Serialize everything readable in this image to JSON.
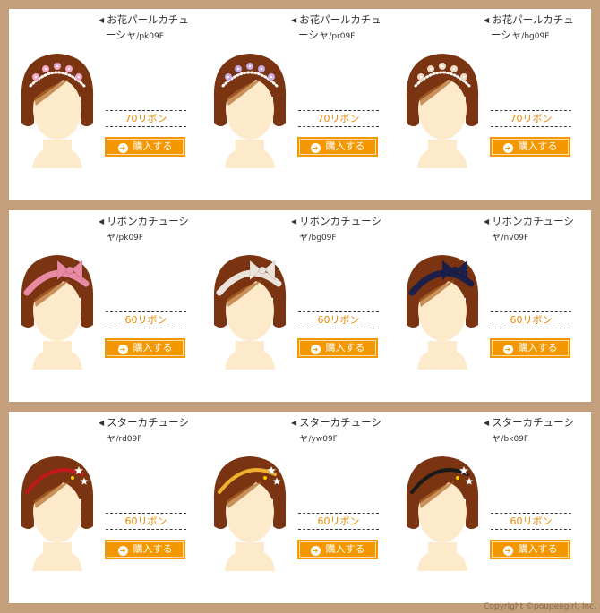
{
  "buy_label": "購入する",
  "copyright": "Copyright ©poupeegirl, Inc.",
  "colors": {
    "background": "#c49f7b",
    "button": "#f39800",
    "price_text": "#e98a00",
    "hair": "#7a3412",
    "skin": "#fdeacb"
  },
  "rows": [
    {
      "items": [
        {
          "line1": "お花パールカチュ",
          "line2": "ーシャ",
          "sku": "/pk09F",
          "price": "70リボン",
          "accessory": "flower-pearl",
          "color": "#f2a7c2"
        },
        {
          "line1": "お花パールカチュ",
          "line2": "ーシャ",
          "sku": "/pr09F",
          "price": "70リボン",
          "accessory": "flower-pearl",
          "color": "#c8a8e0"
        },
        {
          "line1": "お花パールカチュ",
          "line2": "ーシャ",
          "sku": "/bg09F",
          "price": "70リボン",
          "accessory": "flower-pearl",
          "color": "#f0d7c0"
        }
      ]
    },
    {
      "items": [
        {
          "line1": "リボンカチューシ",
          "line2": "ャ",
          "sku": "/pk09F",
          "price": "60リボン",
          "accessory": "ribbon",
          "color": "#e88aa4"
        },
        {
          "line1": "リボンカチューシ",
          "line2": "ャ",
          "sku": "/bg09F",
          "price": "60リボン",
          "accessory": "ribbon",
          "color": "#ece3db"
        },
        {
          "line1": "リボンカチューシ",
          "line2": "ャ",
          "sku": "/nv09F",
          "price": "60リボン",
          "accessory": "ribbon",
          "color": "#1c1f4a"
        }
      ]
    },
    {
      "items": [
        {
          "line1": "スターカチューシ",
          "line2": "ャ",
          "sku": "/rd09F",
          "price": "60リボン",
          "accessory": "star",
          "color": "#c0181c"
        },
        {
          "line1": "スターカチューシ",
          "line2": "ャ",
          "sku": "/yw09F",
          "price": "60リボン",
          "accessory": "star",
          "color": "#f0b030"
        },
        {
          "line1": "スターカチューシ",
          "line2": "ャ",
          "sku": "/bk09F",
          "price": "60リボン",
          "accessory": "star",
          "color": "#1a1a1a"
        }
      ]
    }
  ]
}
